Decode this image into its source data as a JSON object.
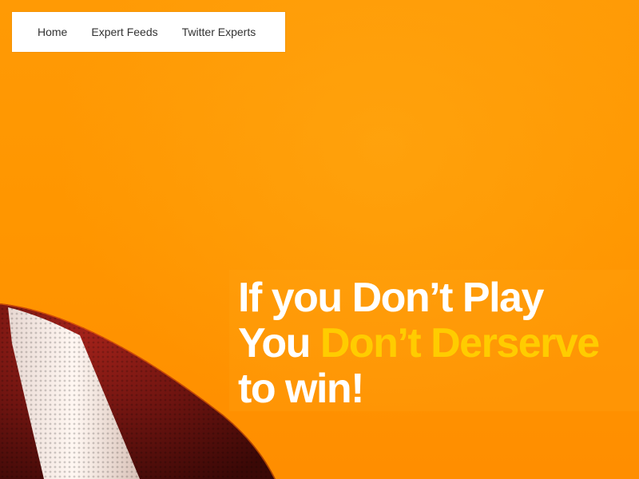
{
  "nav": {
    "items": [
      {
        "label": "Home"
      },
      {
        "label": "Expert Feeds"
      },
      {
        "label": "Twitter Experts"
      }
    ]
  },
  "hero": {
    "line1": "If you Don’t Play",
    "line2_prefix": "You ",
    "line2_accent": "Don’t Derserve",
    "line3": "to win!",
    "colors": {
      "background": "#ff9900",
      "text": "#ffffff",
      "accent": "#ffcc00"
    },
    "image": "american-football"
  }
}
